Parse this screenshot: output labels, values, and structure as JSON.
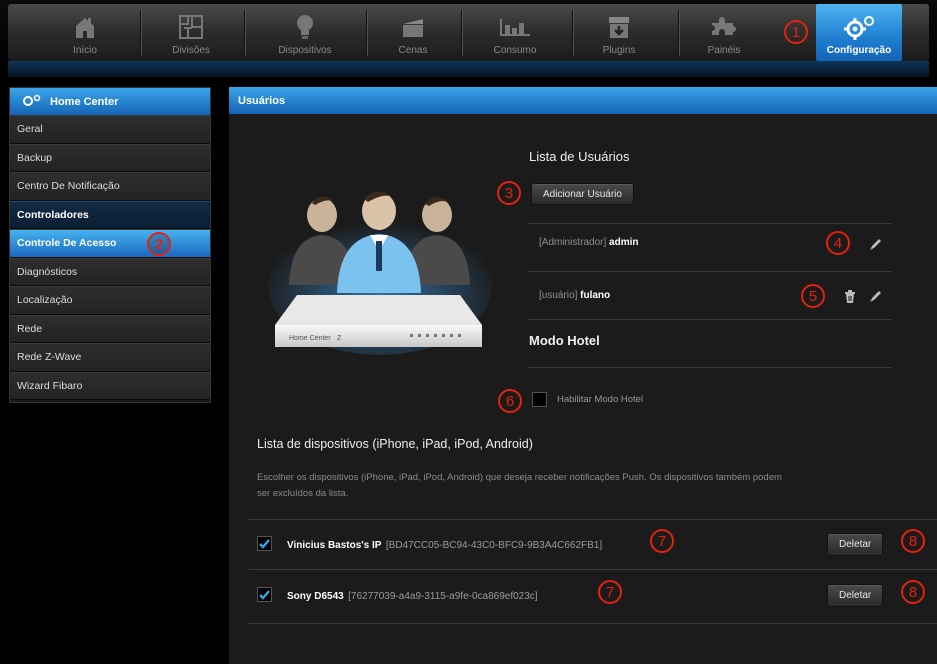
{
  "nav": {
    "tabs": [
      {
        "label": "Início",
        "icon": "home-icon"
      },
      {
        "label": "Divisões",
        "icon": "floorplan-icon"
      },
      {
        "label": "Dispositivos",
        "icon": "lightbulb-icon"
      },
      {
        "label": "Cenas",
        "icon": "clapperboard-icon"
      },
      {
        "label": "Consumo",
        "icon": "bar-chart-icon"
      },
      {
        "label": "Plugins",
        "icon": "plugin-box-icon"
      },
      {
        "label": "Painéis",
        "icon": "puzzle-icon"
      },
      {
        "label": "Configuração",
        "icon": "gears-icon"
      }
    ],
    "active_tab": "Configuração"
  },
  "sidebar": {
    "title": "Home Center",
    "items": [
      {
        "label": "Geral"
      },
      {
        "label": "Backup"
      },
      {
        "label": "Centro De Notificação"
      },
      {
        "label": "Controladores"
      },
      {
        "label": "Controle De Acesso"
      },
      {
        "label": "Diagnósticos"
      },
      {
        "label": "Localização"
      },
      {
        "label": "Rede"
      },
      {
        "label": "Rede Z-Wave"
      },
      {
        "label": "Wizard Fibaro"
      }
    ],
    "active_item": "Controle De Acesso"
  },
  "main": {
    "title": "Usuários",
    "users_heading": "Lista de Usuários",
    "add_user_button": "Adicionar Usuário",
    "users": [
      {
        "role": "[Administrador]",
        "name": "admin"
      },
      {
        "role": "[usuário]",
        "name": "fulano"
      }
    ],
    "hotel_heading": "Modo Hotel",
    "hotel_checkbox_label": "Habilitar Modo Hotel",
    "devices_heading": "Lista de dispositivos (iPhone, iPad, iPod, Android)",
    "devices_description_line1": "Escolher os dispositivos (iPhone, iPad, iPod, Android) que deseja receber notificações Push. Os dispositivos também podem",
    "devices_description_line2": "ser excluídos da lista.",
    "devices": [
      {
        "name": "Vinicius Bastos's IP",
        "id": "[BD47CC05-BC94-43C0-BFC9-9B3A4C662FB1]",
        "checked": true,
        "delete_label": "Deletar"
      },
      {
        "name": "Sony D6543",
        "id": "[76277039-a4a9-3115-a9fe-0ca869ef023c]",
        "checked": true,
        "delete_label": "Deletar"
      }
    ],
    "illustration_labels": [
      "Home Center",
      "Z"
    ]
  },
  "annotations": [
    "1",
    "2",
    "3",
    "4",
    "5",
    "6",
    "7",
    "7",
    "8",
    "8"
  ],
  "colors": {
    "accent_blue": "#1f7fd0",
    "annotation_red": "#e4220e",
    "panel_bg": "#1b1b1b"
  }
}
